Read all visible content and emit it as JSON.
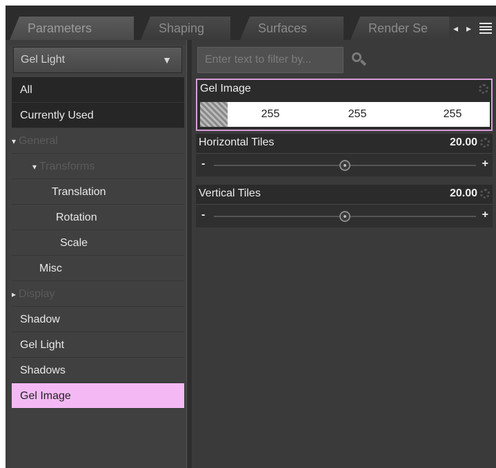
{
  "tabs": [
    {
      "label": "Parameters",
      "active": true
    },
    {
      "label": "Shaping",
      "active": false
    },
    {
      "label": "Surfaces",
      "active": false
    },
    {
      "label": "Render Se",
      "active": false
    }
  ],
  "tab_nav": {
    "prev": "◂",
    "next": "▸"
  },
  "dropdown": {
    "value": "Gel Light",
    "arrow": "▼"
  },
  "tree": {
    "all": "All",
    "currently_used": "Currently Used",
    "general": "General",
    "transforms": "Transforms",
    "translation": "Translation",
    "rotation": "Rotation",
    "scale": "Scale",
    "misc": "Misc",
    "display": "Display",
    "shadow": "Shadow",
    "gel_light": "Gel Light",
    "shadows": "Shadows",
    "gel_image": "Gel Image",
    "expanded_glyph": "▾",
    "collapsed_glyph": "▸"
  },
  "filter": {
    "placeholder": "Enter text to filter by..."
  },
  "properties": {
    "gel_image": {
      "label": "Gel Image",
      "r": "255",
      "g": "255",
      "b": "255"
    },
    "horizontal_tiles": {
      "label": "Horizontal Tiles",
      "value": "20.00",
      "level": 0.5
    },
    "vertical_tiles": {
      "label": "Vertical Tiles",
      "value": "20.00",
      "level": 0.5
    },
    "minus": "-",
    "plus": "+"
  },
  "colors": {
    "selection": "#f4b9f4",
    "panel": "#3d3d3d",
    "accent_border": "#d89cd8"
  }
}
